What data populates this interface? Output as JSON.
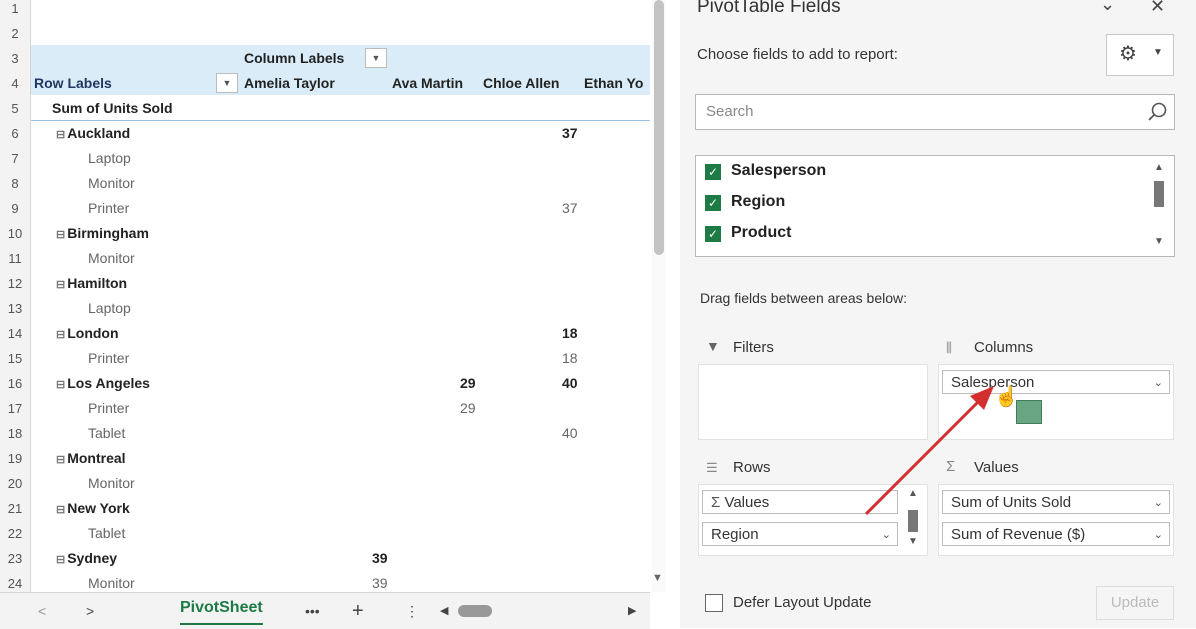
{
  "sheet": {
    "row_numbers": [
      "1",
      "2",
      "3",
      "4",
      "5",
      "6",
      "7",
      "8",
      "9",
      "10",
      "11",
      "12",
      "13",
      "14",
      "15",
      "16",
      "17",
      "18",
      "19",
      "20",
      "21",
      "22",
      "23",
      "24"
    ],
    "column_labels_text": "Column Labels",
    "row_labels_text": "Row Labels",
    "columns": [
      "Amelia Taylor",
      "Ava Martin",
      "Chloe Allen",
      "Ethan Yo"
    ],
    "sum_label": "Sum of Units Sold",
    "rows": [
      {
        "label": "Auckland",
        "region": true,
        "v": [
          "",
          "",
          "37",
          ""
        ]
      },
      {
        "label": "Laptop",
        "region": false,
        "v": [
          "",
          "",
          "",
          ""
        ]
      },
      {
        "label": "Monitor",
        "region": false,
        "v": [
          "",
          "",
          "",
          ""
        ]
      },
      {
        "label": "Printer",
        "region": false,
        "v": [
          "",
          "",
          "37",
          ""
        ]
      },
      {
        "label": "Birmingham",
        "region": true,
        "v": [
          "",
          "",
          "",
          ""
        ]
      },
      {
        "label": "Monitor",
        "region": false,
        "v": [
          "",
          "",
          "",
          ""
        ]
      },
      {
        "label": "Hamilton",
        "region": true,
        "v": [
          "",
          "",
          "",
          ""
        ]
      },
      {
        "label": "Laptop",
        "region": false,
        "v": [
          "",
          "",
          "",
          ""
        ]
      },
      {
        "label": "London",
        "region": true,
        "v": [
          "",
          "",
          "18",
          ""
        ]
      },
      {
        "label": "Printer",
        "region": false,
        "v": [
          "",
          "",
          "18",
          ""
        ]
      },
      {
        "label": "Los Angeles",
        "region": true,
        "v": [
          "",
          "29",
          "40",
          ""
        ]
      },
      {
        "label": "Printer",
        "region": false,
        "v": [
          "",
          "29",
          "",
          ""
        ]
      },
      {
        "label": "Tablet",
        "region": false,
        "v": [
          "",
          "",
          "40",
          ""
        ]
      },
      {
        "label": "Montreal",
        "region": true,
        "v": [
          "",
          "",
          "",
          ""
        ]
      },
      {
        "label": "Monitor",
        "region": false,
        "v": [
          "",
          "",
          "",
          ""
        ]
      },
      {
        "label": "New York",
        "region": true,
        "v": [
          "",
          "",
          "",
          ""
        ]
      },
      {
        "label": "Tablet",
        "region": false,
        "v": [
          "",
          "",
          "",
          ""
        ]
      },
      {
        "label": "Sydney",
        "region": true,
        "v": [
          "39",
          "",
          "",
          ""
        ]
      },
      {
        "label": "Monitor",
        "region": false,
        "v": [
          "39",
          "",
          "",
          ""
        ]
      }
    ]
  },
  "tabs": {
    "prev": "<",
    "next": ">",
    "sheet_name": "PivotSheet",
    "more": "•••",
    "add": "+",
    "options": "⋮"
  },
  "panel": {
    "title": "PivotTable Fields",
    "choose": "Choose fields to add to report:",
    "search_placeholder": "Search",
    "fields": [
      "Salesperson",
      "Region",
      "Product"
    ],
    "drag_hint": "Drag fields between areas below:",
    "filters_label": "Filters",
    "columns_label": "Columns",
    "rows_label": "Rows",
    "values_label": "Values",
    "columns_items": [
      "Salesperson"
    ],
    "rows_items": [
      "Values",
      "Region"
    ],
    "values_items": [
      "Sum of Units Sold",
      "Sum of Revenue ($)"
    ],
    "defer_label": "Defer Layout Update",
    "update_label": "Update"
  },
  "colors": {
    "header_band": "#d9ecf7",
    "checkbox_green": "#1e7b45",
    "arrow_red": "#d32f2f",
    "tab_underline": "#1e7b45"
  }
}
